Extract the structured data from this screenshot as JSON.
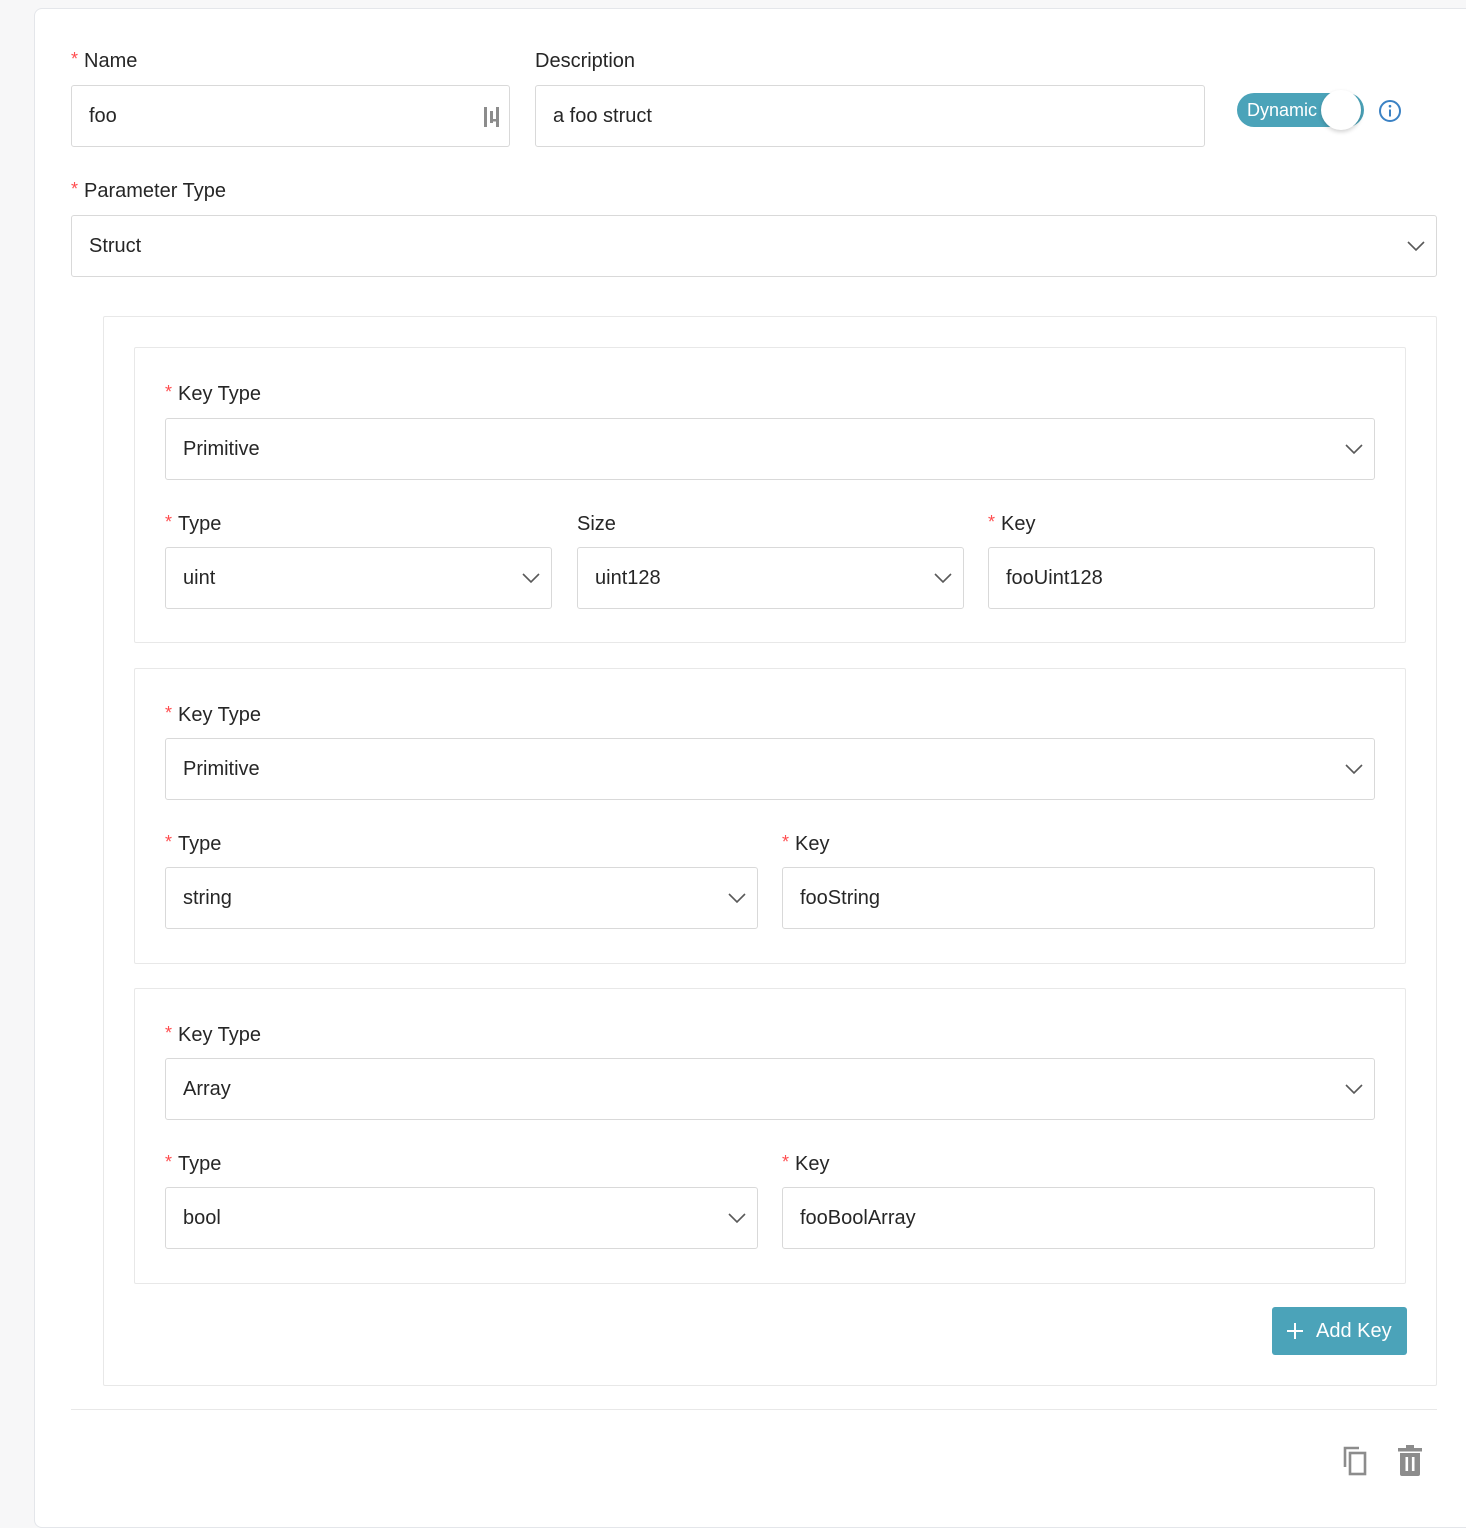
{
  "form": {
    "name": {
      "label": "Name",
      "value": "foo"
    },
    "description": {
      "label": "Description",
      "value": "a foo struct"
    },
    "dynamic_toggle": {
      "label": "Dynamic",
      "checked": true
    },
    "parameter_type": {
      "label": "Parameter Type",
      "value": "Struct"
    }
  },
  "struct_keys": [
    {
      "key_type": {
        "label": "Key Type",
        "value": "Primitive"
      },
      "type": {
        "label": "Type",
        "value": "uint"
      },
      "size": {
        "label": "Size",
        "value": "uint128"
      },
      "key": {
        "label": "Key",
        "value": "fooUint128"
      }
    },
    {
      "key_type": {
        "label": "Key Type",
        "value": "Primitive"
      },
      "type": {
        "label": "Type",
        "value": "string"
      },
      "key": {
        "label": "Key",
        "value": "fooString"
      }
    },
    {
      "key_type": {
        "label": "Key Type",
        "value": "Array"
      },
      "type": {
        "label": "Type",
        "value": "bool"
      },
      "key": {
        "label": "Key",
        "value": "fooBoolArray"
      }
    }
  ],
  "actions": {
    "add_key_label": "Add Key",
    "required_mark": "*"
  },
  "colors": {
    "accent": "#4ba3b9",
    "required": "#ff4d4f",
    "border": "#d9d9d9"
  },
  "icons": [
    "variable-icon",
    "info-icon",
    "chevron-down-icon",
    "plus-icon",
    "copy-icon",
    "trash-icon"
  ]
}
